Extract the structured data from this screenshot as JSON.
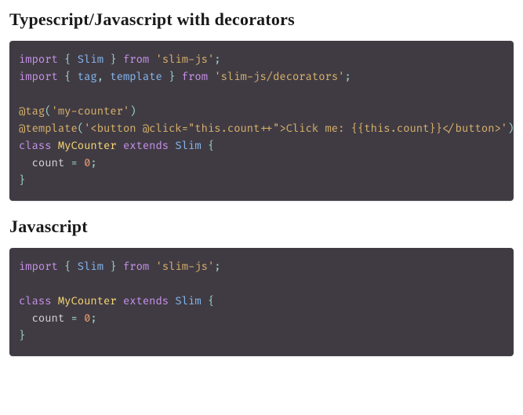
{
  "sections": [
    {
      "heading": "Typescript/Javascript with decorators",
      "code": {
        "lines": [
          [
            {
              "t": "import",
              "c": "tok-kw"
            },
            {
              "t": " ",
              "c": "tok-plain"
            },
            {
              "t": "{",
              "c": "tok-punct"
            },
            {
              "t": " ",
              "c": "tok-plain"
            },
            {
              "t": "Slim",
              "c": "tok-ident"
            },
            {
              "t": " ",
              "c": "tok-plain"
            },
            {
              "t": "}",
              "c": "tok-punct"
            },
            {
              "t": " ",
              "c": "tok-plain"
            },
            {
              "t": "from",
              "c": "tok-kw"
            },
            {
              "t": " ",
              "c": "tok-plain"
            },
            {
              "t": "'slim-js'",
              "c": "tok-str"
            },
            {
              "t": ";",
              "c": "tok-punct"
            }
          ],
          [
            {
              "t": "import",
              "c": "tok-kw"
            },
            {
              "t": " ",
              "c": "tok-plain"
            },
            {
              "t": "{",
              "c": "tok-punct"
            },
            {
              "t": " ",
              "c": "tok-plain"
            },
            {
              "t": "tag",
              "c": "tok-ident"
            },
            {
              "t": ",",
              "c": "tok-punct"
            },
            {
              "t": " ",
              "c": "tok-plain"
            },
            {
              "t": "template",
              "c": "tok-ident"
            },
            {
              "t": " ",
              "c": "tok-plain"
            },
            {
              "t": "}",
              "c": "tok-punct"
            },
            {
              "t": " ",
              "c": "tok-plain"
            },
            {
              "t": "from",
              "c": "tok-kw"
            },
            {
              "t": " ",
              "c": "tok-plain"
            },
            {
              "t": "'slim-js/decorators'",
              "c": "tok-str"
            },
            {
              "t": ";",
              "c": "tok-punct"
            }
          ],
          [],
          [
            {
              "t": "@tag",
              "c": "tok-deco"
            },
            {
              "t": "(",
              "c": "tok-punct"
            },
            {
              "t": "'my-counter'",
              "c": "tok-str"
            },
            {
              "t": ")",
              "c": "tok-punct"
            }
          ],
          [
            {
              "t": "@template",
              "c": "tok-deco"
            },
            {
              "t": "(",
              "c": "tok-punct"
            },
            {
              "t": "'<button ",
              "c": "tok-str"
            },
            {
              "t": "@click",
              "c": "tok-deco"
            },
            {
              "t": "=\"this.count++\">Click me: {{this.count}}</button>'",
              "c": "tok-str"
            },
            {
              "t": ")",
              "c": "tok-punct"
            }
          ],
          [
            {
              "t": "class",
              "c": "tok-kw"
            },
            {
              "t": " ",
              "c": "tok-plain"
            },
            {
              "t": "MyCounter",
              "c": "tok-class"
            },
            {
              "t": " ",
              "c": "tok-plain"
            },
            {
              "t": "extends",
              "c": "tok-kw"
            },
            {
              "t": " ",
              "c": "tok-plain"
            },
            {
              "t": "Slim",
              "c": "tok-ident"
            },
            {
              "t": " ",
              "c": "tok-plain"
            },
            {
              "t": "{",
              "c": "tok-punct"
            }
          ],
          [
            {
              "t": "  count ",
              "c": "tok-plain"
            },
            {
              "t": "=",
              "c": "tok-punct"
            },
            {
              "t": " ",
              "c": "tok-plain"
            },
            {
              "t": "0",
              "c": "tok-num"
            },
            {
              "t": ";",
              "c": "tok-punct"
            }
          ],
          [
            {
              "t": "}",
              "c": "tok-punct"
            }
          ]
        ]
      }
    },
    {
      "heading": "Javascript",
      "code": {
        "lines": [
          [
            {
              "t": "import",
              "c": "tok-kw"
            },
            {
              "t": " ",
              "c": "tok-plain"
            },
            {
              "t": "{",
              "c": "tok-punct"
            },
            {
              "t": " ",
              "c": "tok-plain"
            },
            {
              "t": "Slim",
              "c": "tok-ident"
            },
            {
              "t": " ",
              "c": "tok-plain"
            },
            {
              "t": "}",
              "c": "tok-punct"
            },
            {
              "t": " ",
              "c": "tok-plain"
            },
            {
              "t": "from",
              "c": "tok-kw"
            },
            {
              "t": " ",
              "c": "tok-plain"
            },
            {
              "t": "'slim-js'",
              "c": "tok-str"
            },
            {
              "t": ";",
              "c": "tok-punct"
            }
          ],
          [],
          [
            {
              "t": "class",
              "c": "tok-kw"
            },
            {
              "t": " ",
              "c": "tok-plain"
            },
            {
              "t": "MyCounter",
              "c": "tok-class"
            },
            {
              "t": " ",
              "c": "tok-plain"
            },
            {
              "t": "extends",
              "c": "tok-kw"
            },
            {
              "t": " ",
              "c": "tok-plain"
            },
            {
              "t": "Slim",
              "c": "tok-ident"
            },
            {
              "t": " ",
              "c": "tok-plain"
            },
            {
              "t": "{",
              "c": "tok-punct"
            }
          ],
          [
            {
              "t": "  count ",
              "c": "tok-plain"
            },
            {
              "t": "=",
              "c": "tok-punct"
            },
            {
              "t": " ",
              "c": "tok-plain"
            },
            {
              "t": "0",
              "c": "tok-num"
            },
            {
              "t": ";",
              "c": "tok-punct"
            }
          ],
          [
            {
              "t": "}",
              "c": "tok-punct"
            }
          ]
        ]
      }
    }
  ]
}
